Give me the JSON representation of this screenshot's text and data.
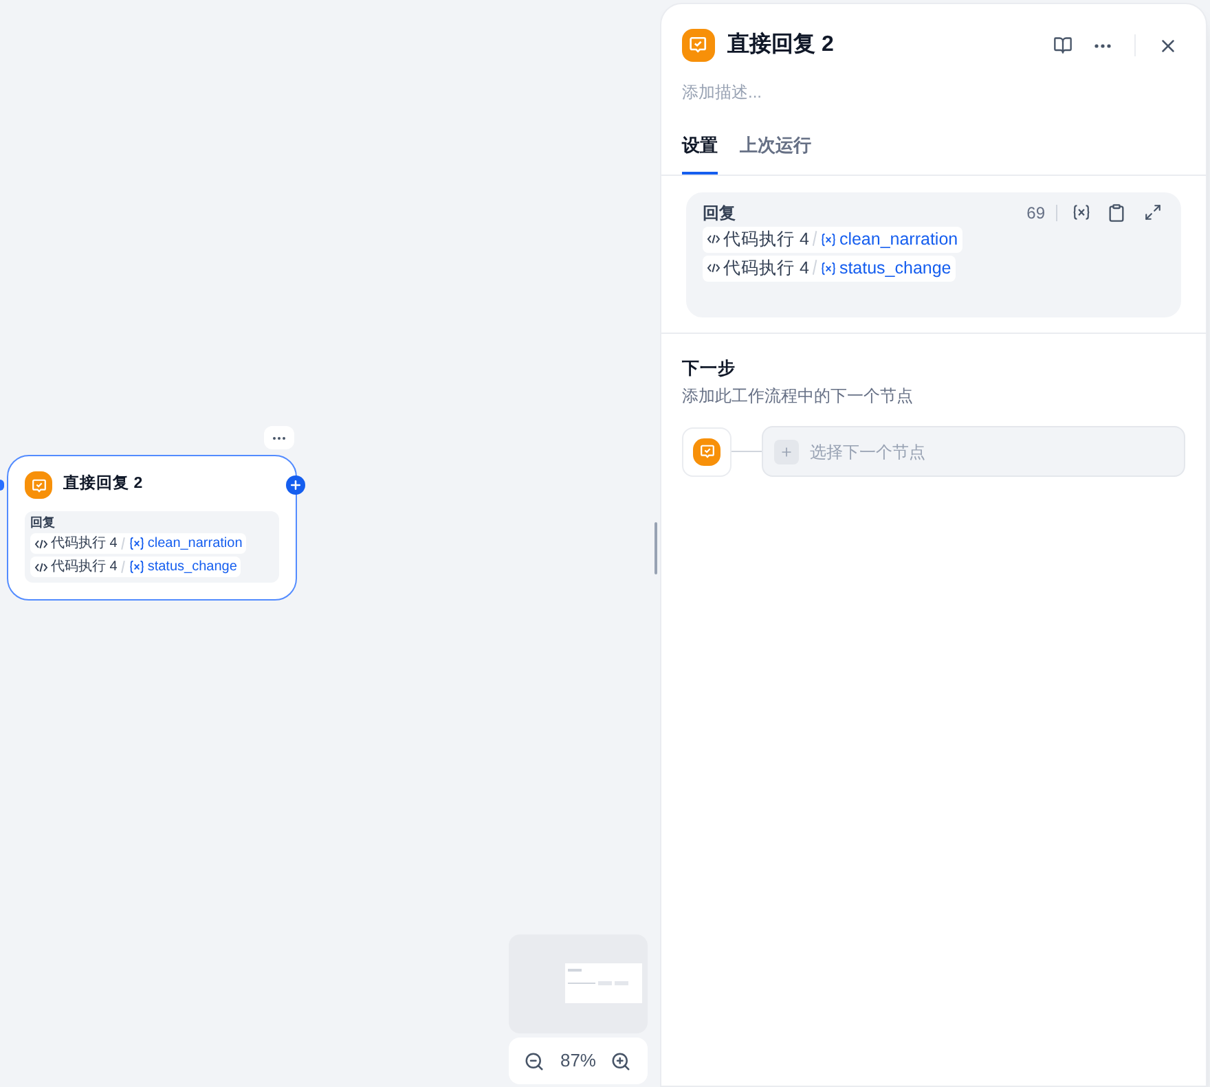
{
  "canvas": {
    "node": {
      "title": "直接回复 2",
      "section_label": "回复",
      "variables": [
        {
          "source": "代码执行 4",
          "name": "clean_narration"
        },
        {
          "source": "代码执行 4",
          "name": "status_change"
        }
      ]
    },
    "zoom": {
      "percent": "87%"
    }
  },
  "panel": {
    "title": "直接回复 2",
    "placeholder": "添加描述...",
    "tabs": [
      {
        "label": "设置",
        "selected": true
      },
      {
        "label": "上次运行",
        "selected": false
      }
    ],
    "reply": {
      "label": "回复",
      "count": "69",
      "variables": [
        {
          "source": "代码执行 4",
          "name": "clean_narration"
        },
        {
          "source": "代码执行 4",
          "name": "status_change"
        }
      ]
    },
    "next_step": {
      "title": "下一步",
      "description": "添加此工作流程中的下一个节点",
      "button_label": "选择下一个节点"
    }
  }
}
